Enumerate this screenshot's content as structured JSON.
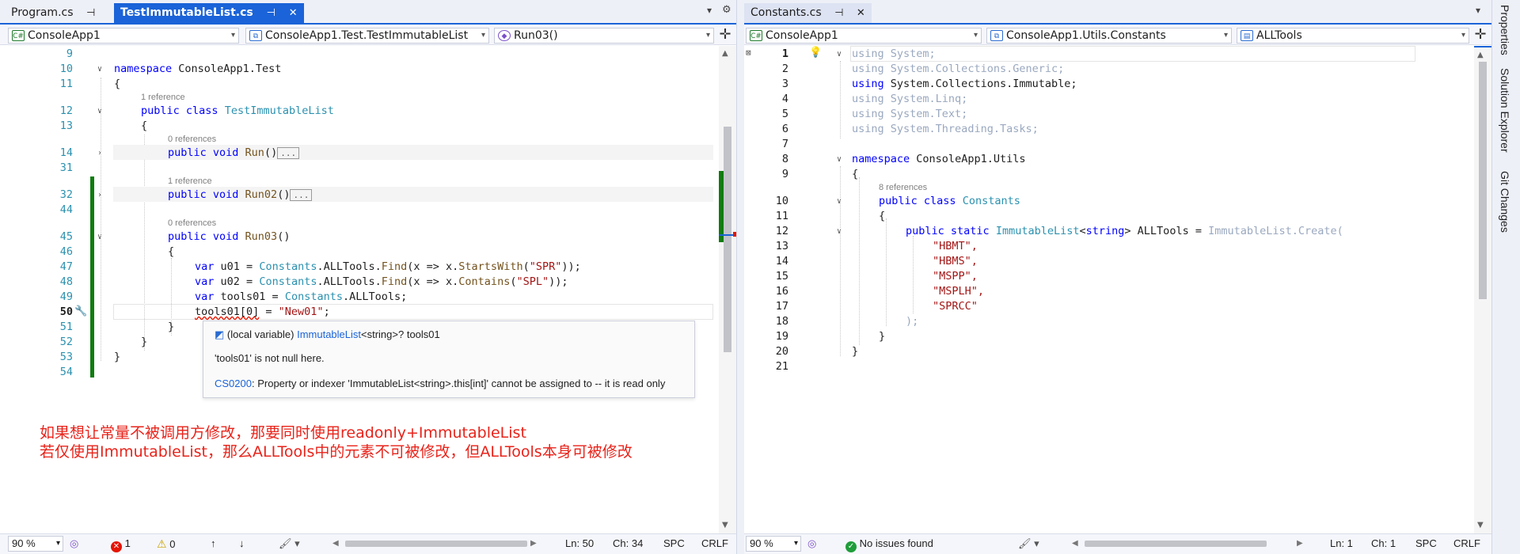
{
  "left": {
    "tabs": [
      {
        "label": "Program.cs",
        "pin": "⊣"
      },
      {
        "label": "TestImmutableList.cs",
        "pin": "⊣",
        "close": "✕"
      }
    ],
    "nav": {
      "project": "ConsoleApp1",
      "type": "ConsoleApp1.Test.TestImmutableList",
      "member": "Run03()"
    },
    "lines": [
      {
        "num": "9"
      },
      {
        "num": "10"
      },
      {
        "num": "11"
      },
      {
        "num": "12"
      },
      {
        "num": "13"
      },
      {
        "num": "14"
      },
      {
        "num": "31"
      },
      {
        "num": "32"
      },
      {
        "num": "44"
      },
      {
        "num": "45"
      },
      {
        "num": "46"
      },
      {
        "num": "47"
      },
      {
        "num": "48"
      },
      {
        "num": "49"
      },
      {
        "num": "50"
      },
      {
        "num": "51"
      },
      {
        "num": "52"
      },
      {
        "num": "53"
      },
      {
        "num": "54"
      }
    ],
    "refs": {
      "class": "1 reference",
      "run": "0 references",
      "run02": "1 reference",
      "run03": "0 references"
    },
    "code": {
      "ns_kw": "namespace",
      "ns_name": "ConsoleApp1.Test",
      "open_brace": "{",
      "close_brace": "}",
      "class_kw": "public class",
      "class_name": "TestImmutableList",
      "run_kw": "public void",
      "run_name": "Run",
      "run_paren": "()",
      "collapsed": "...",
      "run02_name": "Run02",
      "run03_name": "Run03",
      "var_kw": "var",
      "l47_a": "u01 = ",
      "l47_cls": "Constants",
      "l47_b": ".ALLTools.",
      "l47_m": "Find",
      "l47_c": "(x => x.",
      "l47_m2": "StartsWith",
      "l47_d": "(",
      "l47_s": "\"SPR\"",
      "l47_e": "));",
      "l48_a": "u02 = ",
      "l48_cls": "Constants",
      "l48_b": ".ALLTools.",
      "l48_m": "Find",
      "l48_c": "(x => x.",
      "l48_m2": "Contains",
      "l48_d": "(",
      "l48_s": "\"SPL\"",
      "l48_e": "));",
      "l49_a": "tools01 = ",
      "l49_cls": "Constants",
      "l49_b": ".ALLTools;",
      "l50_a": "tools01[0]",
      "l50_b": " = ",
      "l50_s": "\"New01\"",
      "l50_e": ";"
    },
    "tooltip": {
      "kind": "(local variable) ",
      "type": "ImmutableList",
      "type_arg": "<string>",
      "rest": "? tools01",
      "nullinfo": "'tools01' is not null here.",
      "err_code": "CS0200",
      "err_msg": ": Property or indexer 'ImmutableList<string>.this[int]' cannot be assigned to -- it is read only"
    },
    "annotation": {
      "line1": "如果想让常量不被调用方修改，那要同时使用readonly+ImmutableList",
      "line2": "若仅使用ImmutableList，那么ALLTools中的元素不可被修改，但ALLTools本身可被修改"
    },
    "status": {
      "zoom": "90 %",
      "errors": "1",
      "warnings": "0",
      "ln": "Ln: 50",
      "ch": "Ch: 34",
      "spc": "SPC",
      "eol": "CRLF"
    }
  },
  "right": {
    "tabs": [
      {
        "label": "Constants.cs",
        "pin": "⊣",
        "close": "✕"
      }
    ],
    "nav": {
      "project": "ConsoleApp1",
      "type": "ConsoleApp1.Utils.Constants",
      "member": "ALLTools"
    },
    "lines": [
      {
        "num": "1"
      },
      {
        "num": "2"
      },
      {
        "num": "3"
      },
      {
        "num": "4"
      },
      {
        "num": "5"
      },
      {
        "num": "6"
      },
      {
        "num": "7"
      },
      {
        "num": "8"
      },
      {
        "num": "9"
      },
      {
        "num": "10"
      },
      {
        "num": "11"
      },
      {
        "num": "12"
      },
      {
        "num": "13"
      },
      {
        "num": "14"
      },
      {
        "num": "15"
      },
      {
        "num": "16"
      },
      {
        "num": "17"
      },
      {
        "num": "18"
      },
      {
        "num": "19"
      },
      {
        "num": "20"
      },
      {
        "num": "21"
      }
    ],
    "code": {
      "using": "using",
      "u1": "System;",
      "u2": "System.Collections.Generic;",
      "u3": "System.Collections.Immutable;",
      "u4": "System.Linq;",
      "u5": "System.Text;",
      "u6": "System.Threading.Tasks;",
      "ns_kw": "namespace",
      "ns_name": "ConsoleApp1.Utils",
      "refs": "8 references",
      "class_kw": "public class",
      "class_name": "Constants",
      "field_kw": "public static",
      "field_type": "ImmutableList",
      "field_targ": "<",
      "field_str": "string",
      "field_targ2": ">",
      "field_name": " ALLTools = ",
      "field_init": "ImmutableList.Create(",
      "s1": "\"HBMT\",",
      "s2": "\"HBMS\",",
      "s3": "\"MSPP\",",
      "s4": "\"MSPLH\",",
      "s5": "\"SPRCC\"",
      "close_call": ");",
      "open_brace": "{",
      "close_brace": "}"
    },
    "status": {
      "zoom": "90 %",
      "issues": "No issues found",
      "ln": "Ln: 1",
      "ch": "Ch: 1",
      "spc": "SPC",
      "eol": "CRLF"
    }
  },
  "sidebar": {
    "items": [
      "Properties",
      "Solution Explorer",
      "Git Changes"
    ]
  }
}
